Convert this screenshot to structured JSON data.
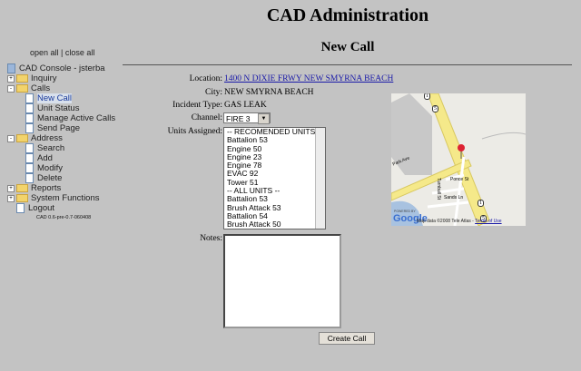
{
  "header": {
    "title": "CAD Administration",
    "subtitle": "New Call"
  },
  "sidebar": {
    "open_all": "open all",
    "separator": "|",
    "close_all": "close all",
    "root": "CAD Console - jsterba",
    "items": [
      {
        "label": "Inquiry",
        "type": "folder",
        "level": 0,
        "expand": "+"
      },
      {
        "label": "Calls",
        "type": "folder",
        "level": 0,
        "expand": "-"
      },
      {
        "label": "New Call",
        "type": "page",
        "level": 1,
        "selected": true
      },
      {
        "label": "Unit Status",
        "type": "page",
        "level": 1
      },
      {
        "label": "Manage Active Calls",
        "type": "page",
        "level": 1
      },
      {
        "label": "Send Page",
        "type": "page",
        "level": 1
      },
      {
        "label": "Address",
        "type": "folder",
        "level": 0,
        "expand": "-"
      },
      {
        "label": "Search",
        "type": "page",
        "level": 1
      },
      {
        "label": "Add",
        "type": "page",
        "level": 1
      },
      {
        "label": "Modify",
        "type": "page",
        "level": 1
      },
      {
        "label": "Delete",
        "type": "page",
        "level": 1
      },
      {
        "label": "Reports",
        "type": "folder",
        "level": 0,
        "expand": "+"
      },
      {
        "label": "System Functions",
        "type": "folder",
        "level": 0,
        "expand": "+"
      },
      {
        "label": "Logout",
        "type": "page",
        "level": 0
      }
    ],
    "version": "CAD 0.6-pre-0.7-060408"
  },
  "form": {
    "location_label": "Location:",
    "location_value": "1400 N DIXIE FRWY NEW SMYRNA BEACH",
    "city_label": "City:",
    "city_value": "NEW SMYRNA BEACH",
    "incident_label": "Incident Type:",
    "incident_value": "GAS LEAK",
    "channel_label": "Channel:",
    "channel_value": "FIRE 3",
    "units_label": "Units Assigned:",
    "units": [
      "-- RECOMENDED UNITS --",
      "Battalion 53",
      "Engine 50",
      "Engine 23",
      "Engine 78",
      "EVAC 92",
      "Tower 51",
      "-- ALL UNITS --",
      "Battalion 53",
      "Brush Attack 53",
      "Battalion 54",
      "Brush Attack 50"
    ],
    "notes_label": "Notes:",
    "notes_value": "",
    "create_button": "Create Call"
  },
  "map": {
    "road_labels": [
      "Park Ave",
      "Ponce St",
      "Turnbull St",
      "Sands Ln"
    ],
    "shields": [
      "1",
      "5",
      "1",
      "5"
    ],
    "powered_by": "POWERED BY",
    "logo": "Google",
    "attribution": "Map data ©2008 Tele Atlas -",
    "terms": "Terms of Use"
  }
}
